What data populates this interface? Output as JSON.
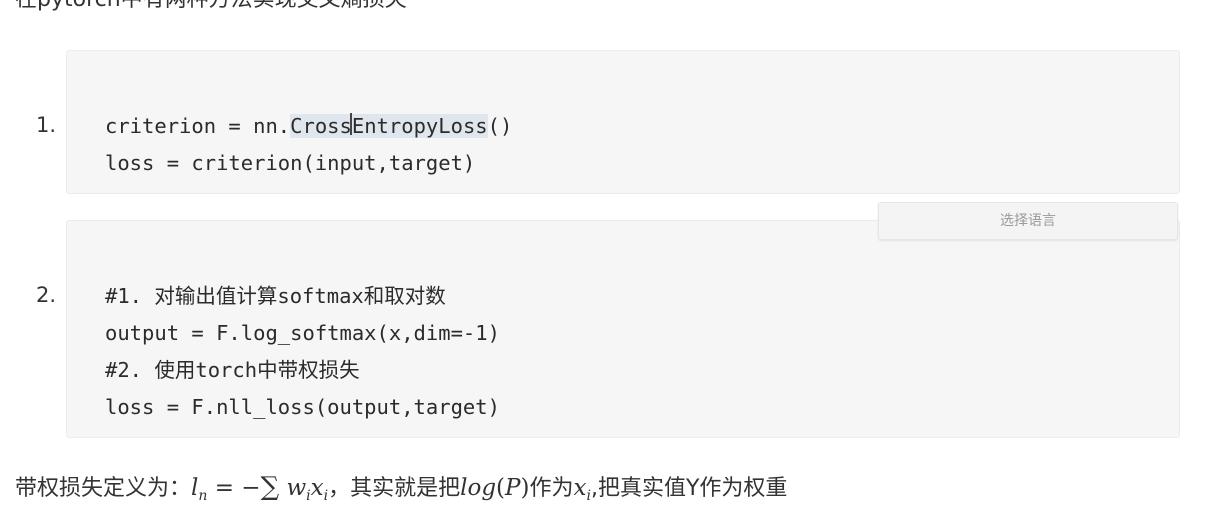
{
  "heading": "在pytorch中有两种方法实现交叉熵损失",
  "blocks": [
    {
      "number": "1.",
      "lines": {
        "l1_pre": "criterion = nn.",
        "l1_hl_a": "Cross",
        "l1_hl_b": "EntropyLoss",
        "l1_post": "()",
        "l2": "loss = criterion(input,target)"
      }
    },
    {
      "number": "2.",
      "lines": {
        "l1": "#1. 对输出值计算softmax和取对数",
        "l2": "output = F.log_softmax(x,dim=-1)",
        "l3": "#2. 使用torch中带权损失",
        "l4": "loss = F.nll_loss(output,target)"
      }
    }
  ],
  "language_select": {
    "label": "选择语言"
  },
  "formula": {
    "prefix": "带权损失定义为：",
    "l": "l",
    "n": "n",
    "eq": " = −",
    "sum": "∑",
    "w": "w",
    "i1": "i",
    "x": "x",
    "i2": "i",
    "mid1": "，其实就是把",
    "log": "log",
    "paren_open": "(",
    "P": "P",
    "paren_close": ")",
    "mid2": "作为",
    "x2": "x",
    "i3": "i",
    "suffix": ",把真实值Y作为权重"
  }
}
